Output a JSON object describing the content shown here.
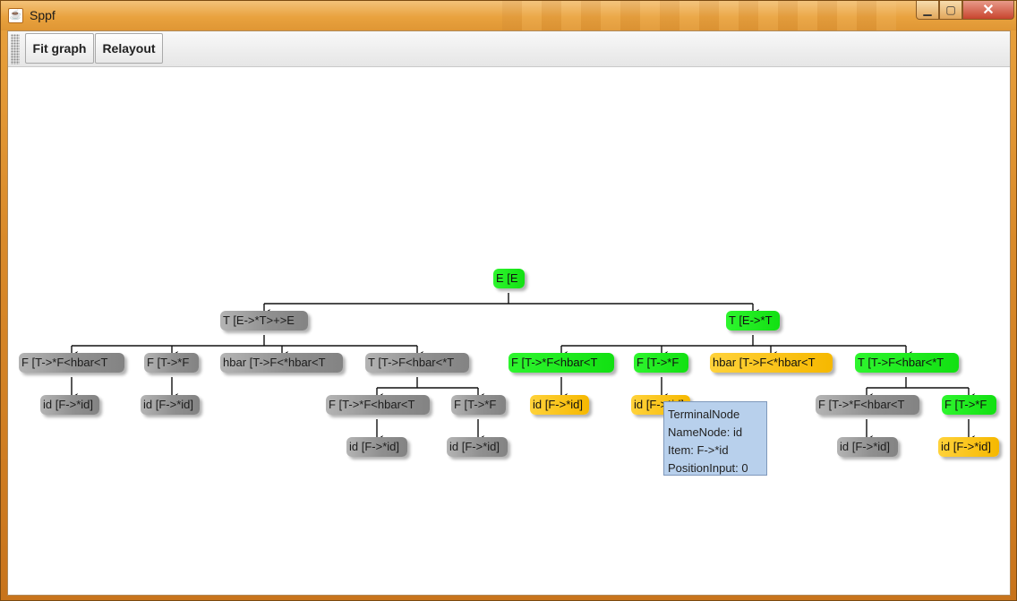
{
  "window": {
    "title": "Sppf",
    "icon": "java-coffee-icon",
    "controls": {
      "minimize": "minimize-icon",
      "maximize": "maximize-icon",
      "close": "close-icon"
    }
  },
  "toolbar": {
    "fit_graph_label": "Fit graph",
    "relayout_label": "Relayout"
  },
  "colors": {
    "gray_node": "#8f8f8f",
    "green_node": "#19e619",
    "orange_node": "#f9c21c",
    "tooltip_bg": "#b8d0ec"
  },
  "graph": {
    "nodes": [
      {
        "id": "n0",
        "label": "E [E",
        "color": "green"
      },
      {
        "id": "n1",
        "label": "T [E->*T>+>E",
        "color": "gray"
      },
      {
        "id": "n2",
        "label": "T [E->*T",
        "color": "green"
      },
      {
        "id": "n3",
        "label": "F [T->*F<hbar<T",
        "color": "gray"
      },
      {
        "id": "n4",
        "label": "F [T->*F",
        "color": "gray"
      },
      {
        "id": "n5",
        "label": "hbar [T->F<*hbar<T",
        "color": "gray"
      },
      {
        "id": "n6",
        "label": "T [T->F<hbar<*T",
        "color": "gray"
      },
      {
        "id": "n7",
        "label": "F [T->*F<hbar<T",
        "color": "green"
      },
      {
        "id": "n8",
        "label": "F [T->*F",
        "color": "green"
      },
      {
        "id": "n9",
        "label": "hbar [T->F<*hbar<T",
        "color": "orange"
      },
      {
        "id": "n10",
        "label": "T [T->F<hbar<*T",
        "color": "green"
      },
      {
        "id": "n11",
        "label": "id [F->*id]",
        "color": "gray"
      },
      {
        "id": "n12",
        "label": "id [F->*id]",
        "color": "gray"
      },
      {
        "id": "n13",
        "label": "F [T->*F<hbar<T",
        "color": "gray"
      },
      {
        "id": "n14",
        "label": "F [T->*F",
        "color": "gray"
      },
      {
        "id": "n15",
        "label": "id [F->*id]",
        "color": "orange"
      },
      {
        "id": "n16",
        "label": "id [F->*id]",
        "color": "orange"
      },
      {
        "id": "n17",
        "label": "F [T->*F<hbar<T",
        "color": "gray"
      },
      {
        "id": "n18",
        "label": "F [T->*F",
        "color": "green"
      },
      {
        "id": "n19",
        "label": "id [F->*id]",
        "color": "gray"
      },
      {
        "id": "n20",
        "label": "id [F->*id]",
        "color": "gray"
      },
      {
        "id": "n21",
        "label": "id [F->*id]",
        "color": "gray"
      },
      {
        "id": "n22",
        "label": "id [F->*id]",
        "color": "orange"
      }
    ]
  },
  "tooltip": {
    "line1": "TerminalNode",
    "line2": "NameNode: id",
    "line3": "Item: F->*id",
    "line4": "PositionInput: 0"
  }
}
